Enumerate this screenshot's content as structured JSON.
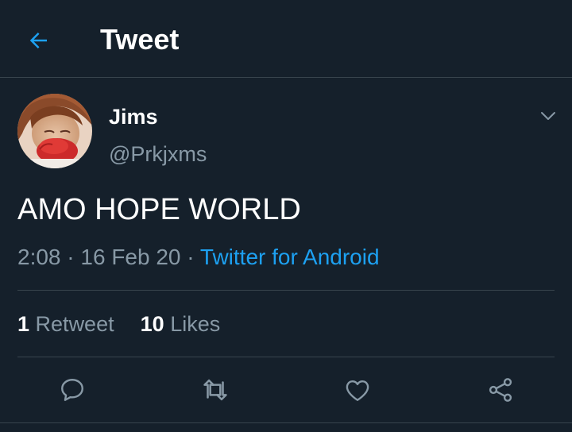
{
  "header": {
    "title": "Tweet",
    "back_icon": "arrow-left-icon"
  },
  "colors": {
    "background": "#15202b",
    "accent": "#1da1f2",
    "secondary_text": "#8899a6",
    "divider": "#38444d"
  },
  "tweet": {
    "author": {
      "display_name": "Jims",
      "handle": "@Prkjxms"
    },
    "text": "AMO HOPE WORLD",
    "time": "2:08",
    "date": "16 Feb 20",
    "separator": "·",
    "source": "Twitter for Android",
    "stats": {
      "retweets_count": "1",
      "retweets_label": "Retweet",
      "likes_count": "10",
      "likes_label": "Likes"
    },
    "actions": [
      "reply-icon",
      "retweet-icon",
      "like-icon",
      "share-icon"
    ],
    "more_icon": "chevron-down-icon"
  }
}
